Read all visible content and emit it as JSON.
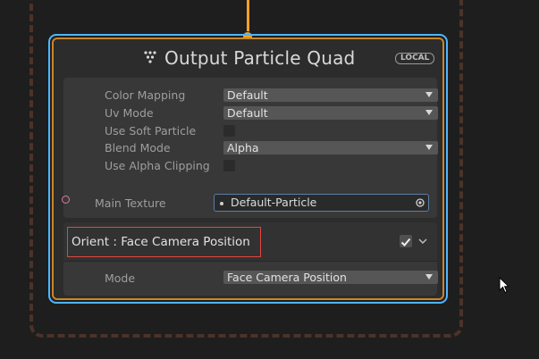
{
  "node": {
    "title": "Output Particle Quad",
    "badge": "LOCAL"
  },
  "settings": {
    "color_mapping": {
      "label": "Color Mapping",
      "value": "Default"
    },
    "uv_mode": {
      "label": "Uv Mode",
      "value": "Default"
    },
    "use_soft_particle": {
      "label": "Use Soft Particle",
      "checked": false
    },
    "blend_mode": {
      "label": "Blend Mode",
      "value": "Alpha"
    },
    "use_alpha_clipping": {
      "label": "Use Alpha Clipping",
      "checked": false
    }
  },
  "main_texture": {
    "label": "Main Texture",
    "value": "Default-Particle"
  },
  "orient_block": {
    "title": "Orient : Face Camera Position",
    "enabled": true,
    "mode": {
      "label": "Mode",
      "value": "Face Camera Position"
    }
  },
  "colors": {
    "flow": "#f2a224",
    "selection": "#4fb5ff",
    "highlight": "#e2453f",
    "texture_port": "#e07aa6"
  },
  "icons": {
    "header": "vfx-output-icon",
    "texture_picker": "object-picker-icon",
    "collapse": "chevron-down-icon"
  }
}
